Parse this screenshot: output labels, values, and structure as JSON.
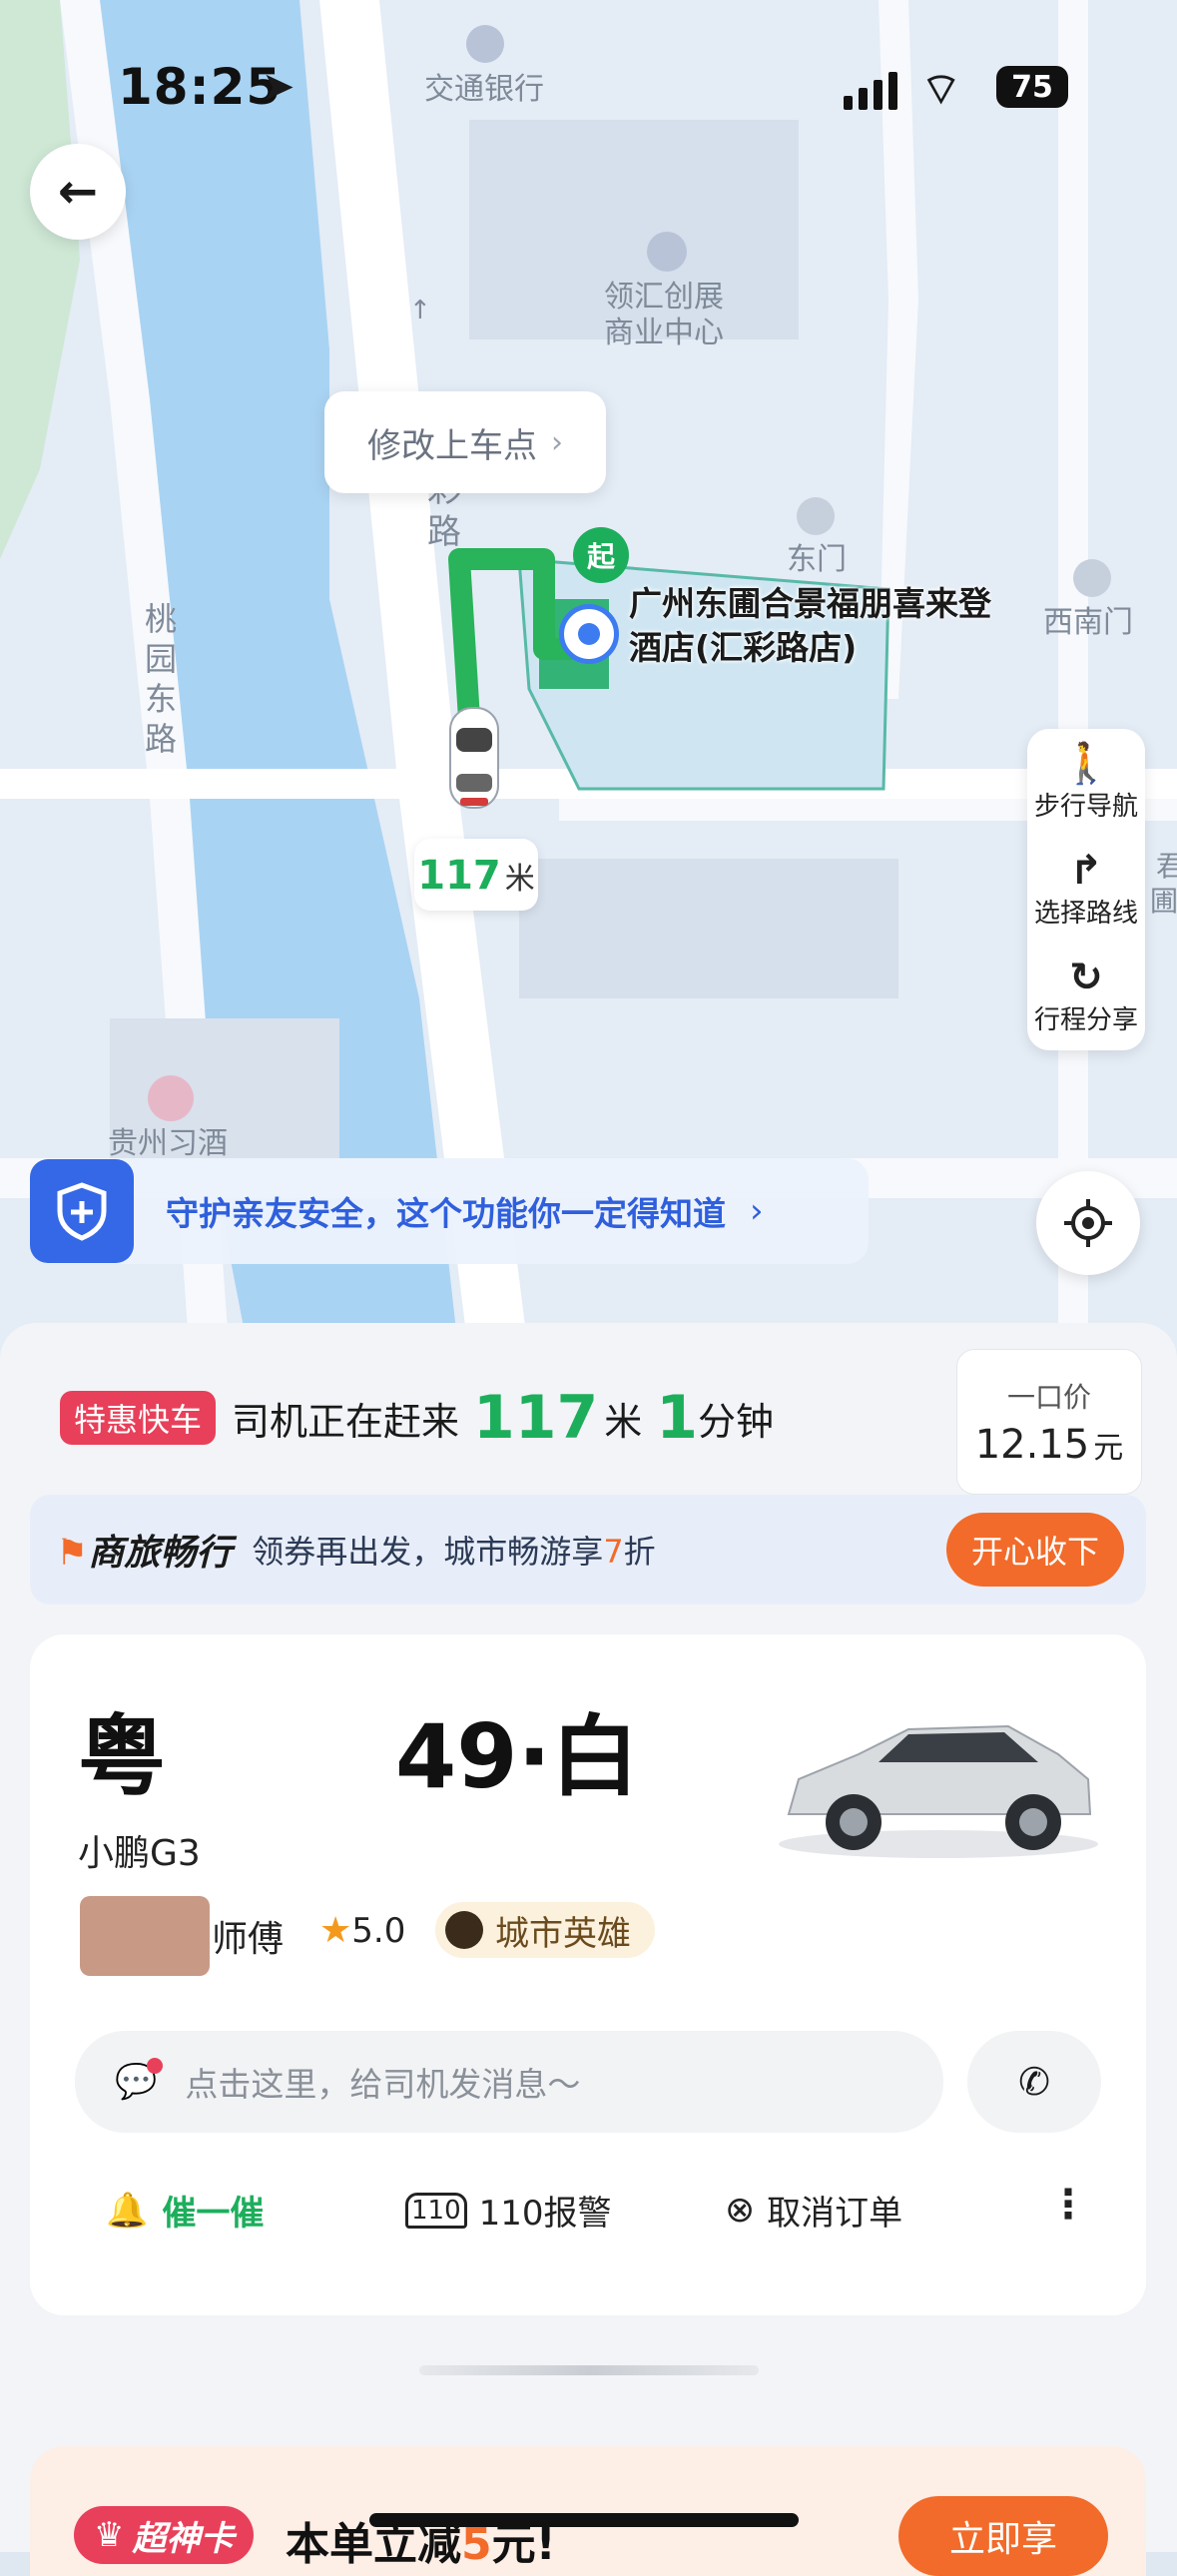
{
  "status_bar": {
    "time": "18:25",
    "battery": "75"
  },
  "map": {
    "poi_bank": "交通银行",
    "poi_mall_1": "领汇创展",
    "poi_mall_2": "商业中心",
    "road_caili": "彩路",
    "road_taoyuan": "桃园东路",
    "gate_east": "东门",
    "gate_southwest": "西南门",
    "poi_guizhou": "贵州习酒",
    "edit_pickup": "修改上车点",
    "start_marker": "起",
    "hotel_line1": "广州东圃合景福朋喜来登",
    "hotel_line2": "酒店(汇彩路店)",
    "distance_num": "117",
    "distance_unit": "米",
    "edge_char_1": "君",
    "edge_char_2": "圃"
  },
  "side_actions": [
    {
      "label": "步行导航",
      "icon": "walk-icon"
    },
    {
      "label": "选择路线",
      "icon": "route-icon"
    },
    {
      "label": "行程分享",
      "icon": "share-icon"
    }
  ],
  "safety_banner": {
    "text": "守护亲友安全，这个功能你一定得知道"
  },
  "order": {
    "badge": "特惠快车",
    "status_prefix": "司机正在赶来",
    "distance": "117",
    "distance_unit": "米",
    "minutes": "1",
    "minutes_unit": "分钟",
    "price_label": "一口价",
    "price_value": "12.15",
    "price_unit": "元"
  },
  "promo": {
    "brand": "商旅畅行",
    "text_before": "领券再出发，城市畅游享",
    "discount": "7",
    "text_after": "折",
    "button": "开心收下"
  },
  "driver": {
    "plate_prefix": "粤",
    "plate_suffix": "49·白",
    "car_model": "小鹏G3",
    "name_suffix": "师傅",
    "rating": "5.0",
    "tag": "城市英雄",
    "message_placeholder": "点击这里，给司机发消息～"
  },
  "actions": {
    "urge": "催一催",
    "police": "110报警",
    "cancel": "取消订单"
  },
  "bottom_promo": {
    "brand": "超神卡",
    "text_before": "本单立减",
    "amount": "5",
    "text_after": "元!",
    "button": "立即享"
  },
  "colors": {
    "accent_green": "#1dae5c",
    "accent_orange": "#f26b2a",
    "badge_red": "#e8405a",
    "link_blue": "#2f5fdc"
  }
}
